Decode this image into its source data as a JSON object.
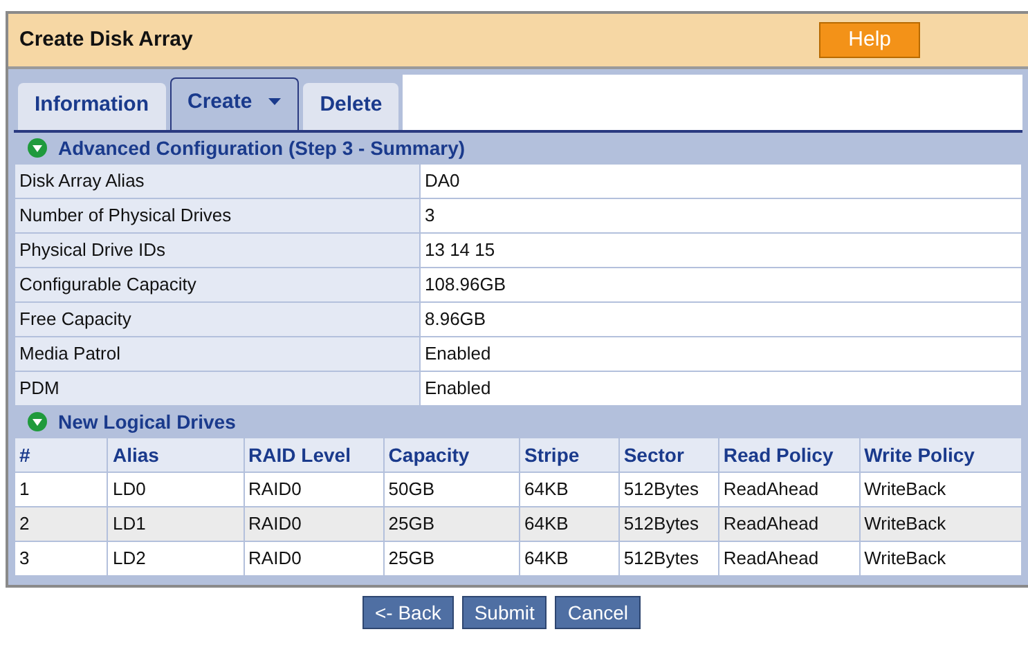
{
  "header": {
    "title": "Create Disk Array",
    "help": "Help"
  },
  "tabs": [
    {
      "label": "Information",
      "selected": false,
      "dropdown": false
    },
    {
      "label": "Create",
      "selected": true,
      "dropdown": true
    },
    {
      "label": "Delete",
      "selected": false,
      "dropdown": false
    }
  ],
  "summary": {
    "title": "Advanced Configuration (Step 3 - Summary)",
    "expanded": true,
    "rows": [
      {
        "label": "Disk Array Alias",
        "value": "DA0"
      },
      {
        "label": "Number of Physical Drives",
        "value": "3"
      },
      {
        "label": "Physical Drive IDs",
        "value": "13 14 15"
      },
      {
        "label": "Configurable Capacity",
        "value": "108.96GB"
      },
      {
        "label": "Free Capacity",
        "value": "8.96GB"
      },
      {
        "label": "Media Patrol",
        "value": "Enabled"
      },
      {
        "label": "PDM",
        "value": "Enabled"
      }
    ]
  },
  "logical_drives": {
    "title": "New Logical Drives",
    "expanded": true,
    "columns": [
      "#",
      "Alias",
      "RAID Level",
      "Capacity",
      "Stripe",
      "Sector",
      "Read Policy",
      "Write Policy"
    ],
    "rows": [
      [
        "1",
        "LD0",
        "RAID0",
        "50GB",
        "64KB",
        "512Bytes",
        "ReadAhead",
        "WriteBack"
      ],
      [
        "2",
        "LD1",
        "RAID0",
        "25GB",
        "64KB",
        "512Bytes",
        "ReadAhead",
        "WriteBack"
      ],
      [
        "3",
        "LD2",
        "RAID0",
        "25GB",
        "64KB",
        "512Bytes",
        "ReadAhead",
        "WriteBack"
      ]
    ]
  },
  "buttons": [
    "<- Back",
    "Submit",
    "Cancel"
  ]
}
